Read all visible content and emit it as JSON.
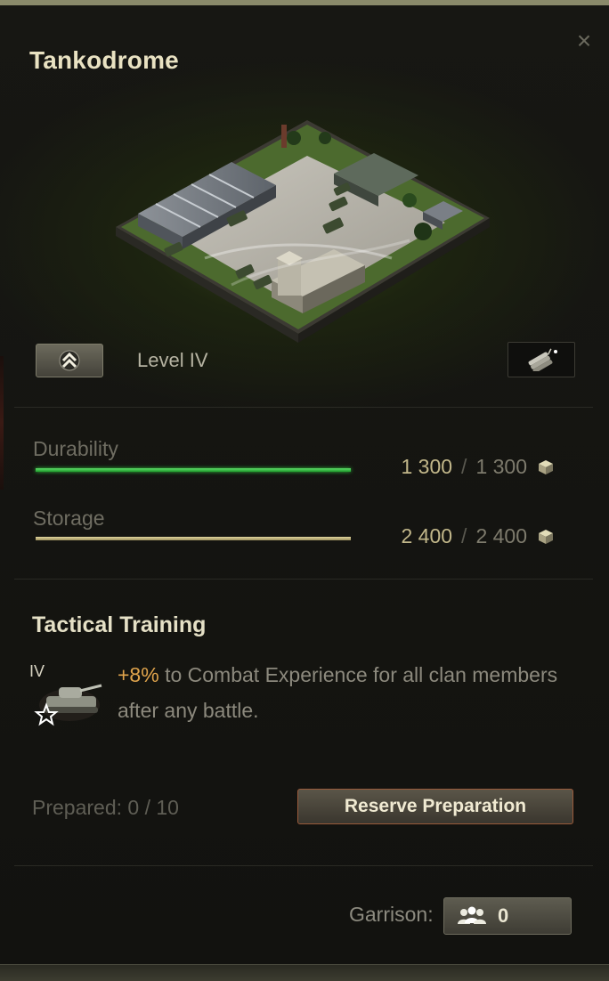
{
  "window": {
    "title": "Tankodrome",
    "close_icon": "close-icon"
  },
  "building": {
    "level_label": "Level IV",
    "upgrade_icon": "double-chevron-up-icon",
    "demolish_icon": "dynamite-icon"
  },
  "stats": {
    "durability": {
      "label": "Durability",
      "current": "1 300",
      "separator": "/",
      "max": "1 300",
      "fill_percent": 100,
      "color": "#2fbf3c",
      "icon": "industrial-resource-icon"
    },
    "storage": {
      "label": "Storage",
      "current": "2 400",
      "separator": "/",
      "max": "2 400",
      "fill_percent": 100,
      "color": "#d8cc94",
      "icon": "industrial-resource-icon"
    }
  },
  "reserve": {
    "title": "Tactical Training",
    "tier": "IV",
    "bonus_value": "+8%",
    "bonus_text": " to Combat Experience for all clan members after any battle.",
    "prepared": "Prepared: 0 / 10",
    "reserve_button": "Reserve Preparation",
    "reserve_icon": "tank-star-icon"
  },
  "garrison": {
    "label": "Garrison:",
    "count": "0",
    "icon": "people-icon"
  },
  "colors": {
    "accent_gold": "#e0a44c",
    "title": "#e9e2c2"
  }
}
